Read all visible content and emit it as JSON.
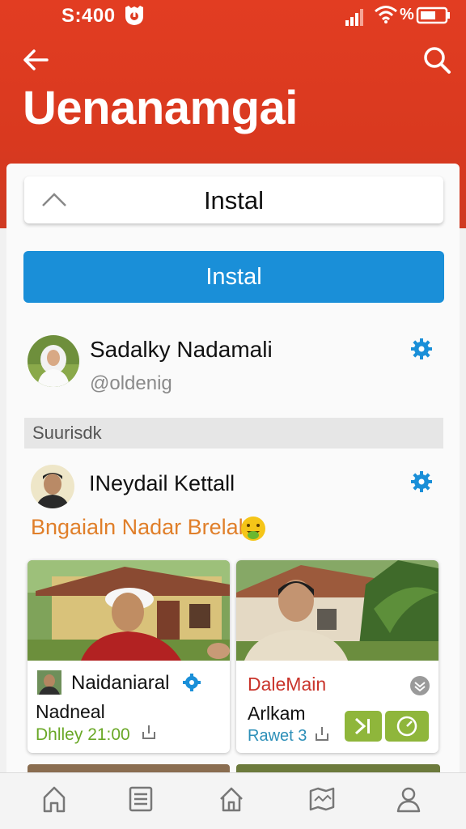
{
  "status": {
    "time": "S:400",
    "battery_label": "%"
  },
  "header": {
    "title": "Uenanamgai"
  },
  "collapse_bar": {
    "label": "Instal"
  },
  "install_button": {
    "label": "Instal"
  },
  "profile": {
    "name": "Sadalky Nadamali",
    "handle": "@oldenig"
  },
  "section": {
    "label": "Suurisdk"
  },
  "post": {
    "author": "INeydail Kettall",
    "text": "Bngaialn Nadar Brelal?",
    "cards": [
      {
        "name": "Naidaniaral",
        "subtitle": "Nadneal",
        "meta": "Dhlley 21:00"
      },
      {
        "name": "DaleMain",
        "subtitle": "Arlkam",
        "meta": "Rawet 3"
      }
    ]
  },
  "colors": {
    "header": "#dd3b20",
    "accent_blue": "#1a8fd8",
    "green": "#8fb63b",
    "orange_text": "#e07f2a"
  },
  "nav": {
    "items": [
      "home-icon",
      "list-icon",
      "home-alt-icon",
      "map-icon",
      "user-icon"
    ]
  }
}
